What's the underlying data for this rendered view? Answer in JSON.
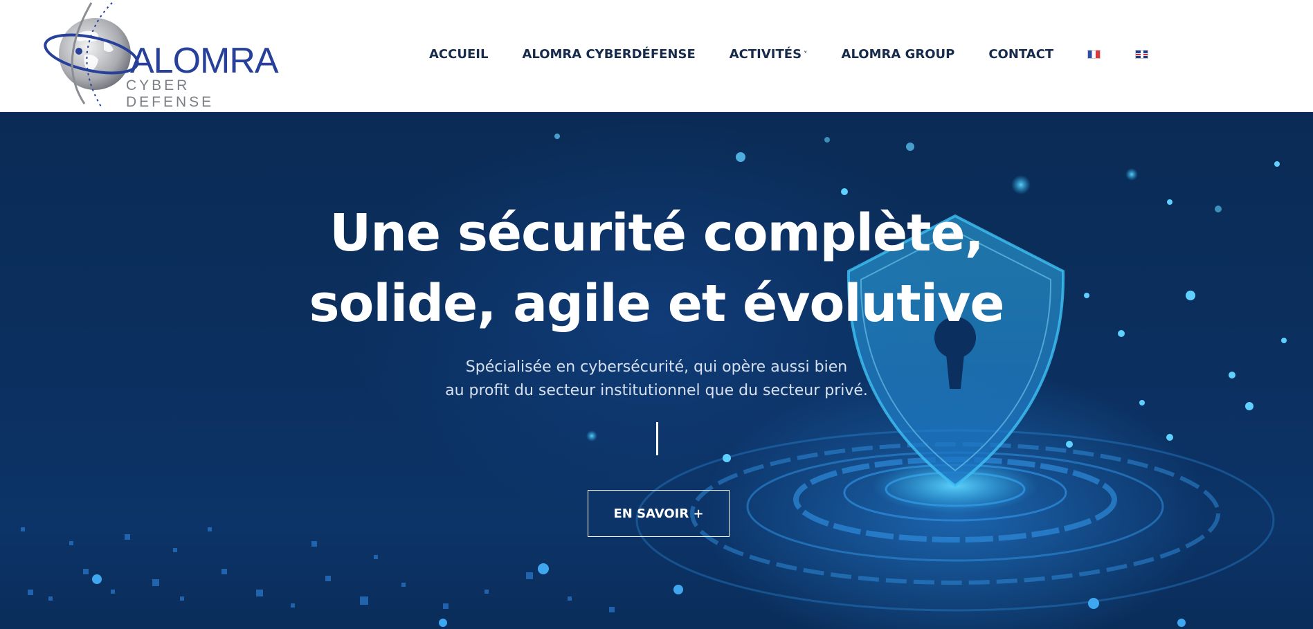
{
  "brand": {
    "logo_title": "ALOMRA",
    "logo_subtitle": "CYBER DEFENSE"
  },
  "nav": {
    "items": [
      {
        "label": "ACCUEIL"
      },
      {
        "label": "ALOMRA CYBERDÉFENSE"
      },
      {
        "label": "ACTIVITÉS",
        "has_dropdown": true
      },
      {
        "label": "ALOMRA GROUP"
      },
      {
        "label": "CONTACT"
      }
    ],
    "languages": [
      {
        "name": "fr-flag-icon"
      },
      {
        "name": "uk-flag-icon"
      }
    ]
  },
  "hero": {
    "headline_line1": "Une sécurité complète,",
    "headline_line2": "solide, agile et évolutive",
    "subtext_line1": "Spécialisée en cybersécurité, qui opère aussi bien",
    "subtext_line2": "au profit du secteur institutionnel que du secteur privé.",
    "cta_label": "EN SAVOIR +"
  },
  "colors": {
    "nav_text": "#172b4d",
    "brand_blue": "#27409a",
    "brand_gray": "#7b7f86",
    "hero_bg": "#0b2f5e",
    "hero_glow": "#2ab4f0",
    "hero_text": "#ffffff"
  }
}
